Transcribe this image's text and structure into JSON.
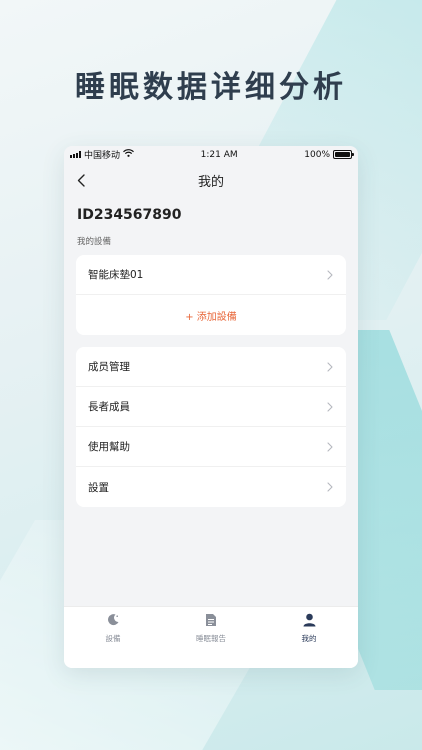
{
  "headline": "睡眠数据详细分析",
  "status_bar": {
    "carrier": "中国移动",
    "time": "1:21 AM",
    "battery_text": "100%",
    "battery_level": 1.0
  },
  "nav": {
    "title": "我的"
  },
  "profile": {
    "user_id": "ID234567890"
  },
  "devices": {
    "section_label": "我的設備",
    "items": [
      {
        "label": "智能床墊01"
      }
    ],
    "add_label": "+ 添加設備"
  },
  "menu": {
    "items": [
      {
        "label": "成员管理"
      },
      {
        "label": "長者成員"
      },
      {
        "label": "使用幫助"
      },
      {
        "label": "設置"
      }
    ]
  },
  "tabs": [
    {
      "label": "設備",
      "icon": "moon-icon",
      "active": false
    },
    {
      "label": "睡眠報告",
      "icon": "report-icon",
      "active": false
    },
    {
      "label": "我的",
      "icon": "person-icon",
      "active": true
    }
  ],
  "colors": {
    "accent": "#e8673a",
    "tab_active": "#2b3b5a",
    "tab_inactive": "#8a8f99"
  }
}
